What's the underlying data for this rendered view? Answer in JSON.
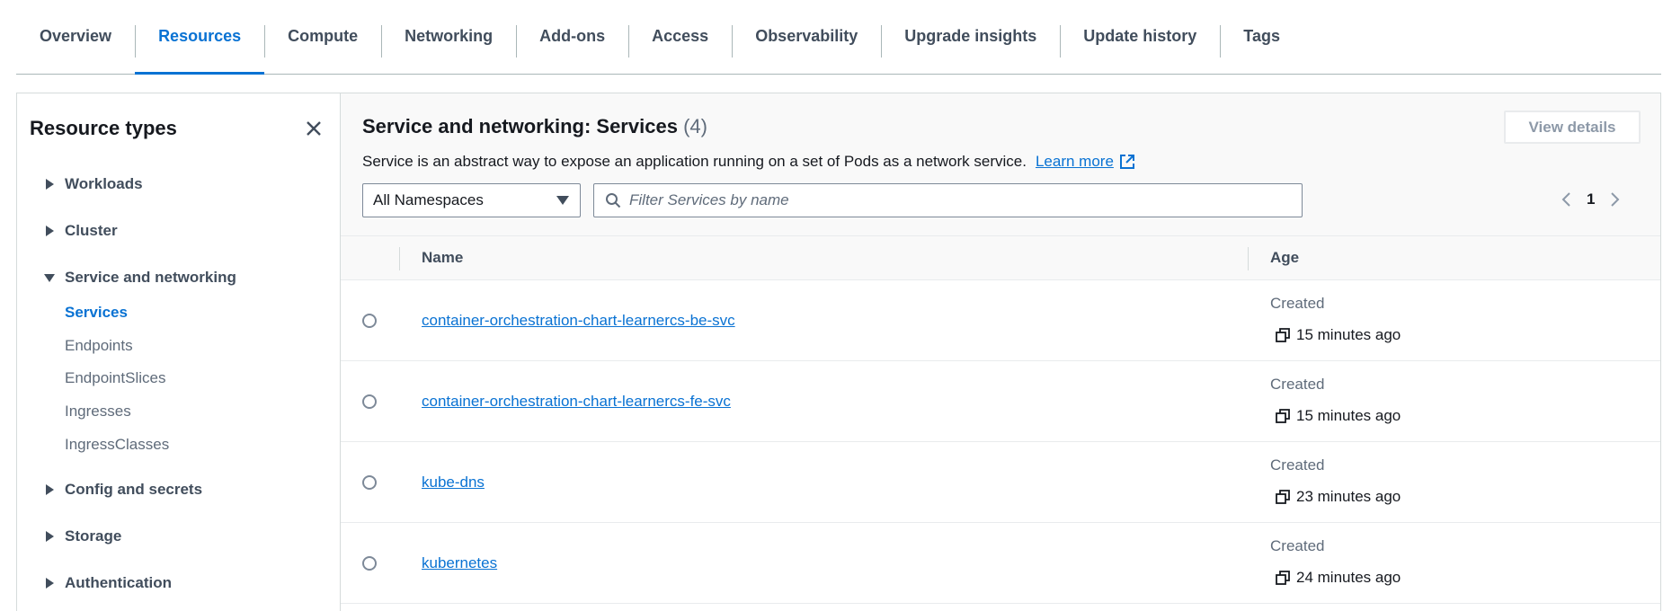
{
  "tabs": [
    {
      "label": "Overview"
    },
    {
      "label": "Resources",
      "active": true
    },
    {
      "label": "Compute"
    },
    {
      "label": "Networking"
    },
    {
      "label": "Add-ons"
    },
    {
      "label": "Access"
    },
    {
      "label": "Observability"
    },
    {
      "label": "Upgrade insights"
    },
    {
      "label": "Update history"
    },
    {
      "label": "Tags"
    }
  ],
  "sidebar": {
    "title": "Resource types",
    "groups": {
      "workloads": "Workloads",
      "cluster": "Cluster",
      "service_networking": "Service and networking",
      "config_secrets": "Config and secrets",
      "storage": "Storage",
      "authentication": "Authentication"
    },
    "service_items": [
      "Services",
      "Endpoints",
      "EndpointSlices",
      "Ingresses",
      "IngressClasses"
    ],
    "active_item": "Services"
  },
  "main": {
    "title": "Service and networking: Services",
    "count": "(4)",
    "description": "Service is an abstract way to expose an application running on a set of Pods as a network service.",
    "learn_more": "Learn more",
    "view_details": "View details",
    "namespace_select": "All Namespaces",
    "search_placeholder": "Filter Services by name",
    "page": "1"
  },
  "table": {
    "columns": {
      "name": "Name",
      "age": "Age"
    },
    "rows": [
      {
        "name": "container-orchestration-chart-learnercs-be-svc",
        "age_label": "Created",
        "age": "15 minutes ago"
      },
      {
        "name": "container-orchestration-chart-learnercs-fe-svc",
        "age_label": "Created",
        "age": "15 minutes ago"
      },
      {
        "name": "kube-dns",
        "age_label": "Created",
        "age": "23 minutes ago"
      },
      {
        "name": "kubernetes",
        "age_label": "Created",
        "age": "24 minutes ago"
      }
    ]
  },
  "colors": {
    "accent": "#0972d3",
    "text": "#16191f",
    "muted": "#5f6b7a",
    "border": "#7d8998"
  }
}
